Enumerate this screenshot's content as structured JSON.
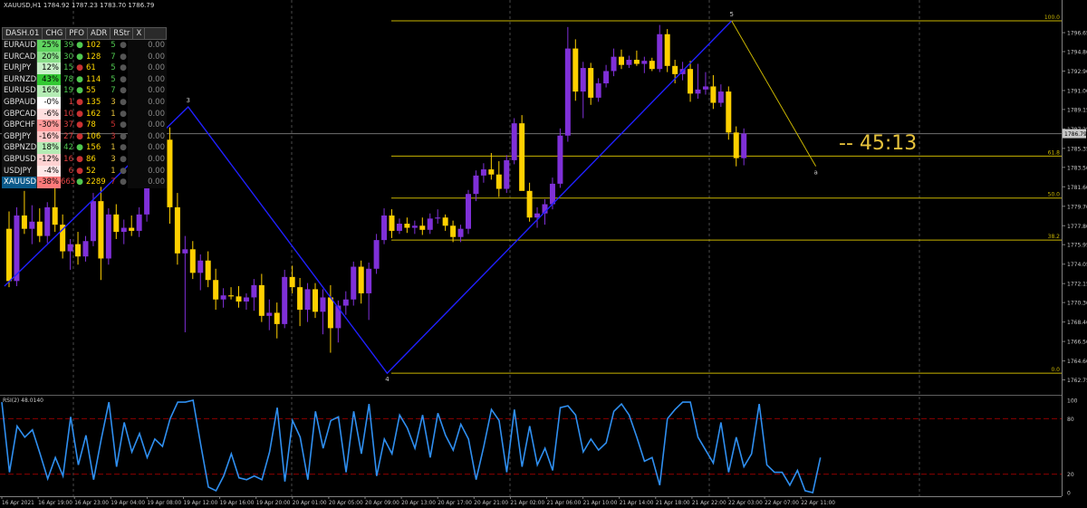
{
  "window": {
    "title": "XAUUSD,H1  1784.92 1787.23 1783.70 1786.79"
  },
  "colors": {
    "bull": "#7f30d8",
    "bear": "#ffd000",
    "zigzag": "#2020ff",
    "fib": "#c8b400",
    "rsi": "#2f8ff0",
    "rsi_level": "#8b0000",
    "grid": "#4a4a4a"
  },
  "dashboard": {
    "headers": [
      "DASH.01",
      "CHG",
      "PFO",
      "ADR",
      "RStr",
      "X"
    ],
    "rows": [
      {
        "sym": "EURAUD",
        "chg": "25%",
        "chg_color": "#5fd35f",
        "pfo": "39",
        "dot": "#50c850",
        "adr": "102",
        "rstr": "5",
        "rstr_color": "#50c850",
        "val": "0.00"
      },
      {
        "sym": "EURCAD",
        "chg": "20%",
        "chg_color": "#8be08b",
        "pfo": "30",
        "dot": "#50c850",
        "adr": "128",
        "rstr": "7",
        "rstr_color": "#50c850",
        "val": "0.00"
      },
      {
        "sym": "EURJPY",
        "chg": "12%",
        "chg_color": "#c8f0c8",
        "pfo": "15",
        "dot": "#c83232",
        "adr": "61",
        "rstr": "5",
        "rstr_color": "#50c850",
        "val": "0.00"
      },
      {
        "sym": "EURNZD",
        "chg": "43%",
        "chg_color": "#32c832",
        "pfo": "78",
        "dot": "#50c850",
        "adr": "114",
        "rstr": "5",
        "rstr_color": "#50c850",
        "val": "0.00"
      },
      {
        "sym": "EURUSD",
        "chg": "16%",
        "chg_color": "#b4ebb4",
        "pfo": "19",
        "dot": "#50c850",
        "adr": "55",
        "rstr": "7",
        "rstr_color": "#50c850",
        "val": "0.00"
      },
      {
        "sym": "GBPAUD",
        "chg": "-0%",
        "chg_color": "#ffffff",
        "pfo": "1",
        "dot": "#c83232",
        "adr": "135",
        "rstr": "3",
        "rstr_color": "#e6c23c",
        "val": "0.00"
      },
      {
        "sym": "GBPCAD",
        "chg": "-6%",
        "chg_color": "#ffe0e0",
        "pfo": "10",
        "dot": "#c83232",
        "adr": "162",
        "rstr": "1",
        "rstr_color": "#e6c23c",
        "val": "0.00"
      },
      {
        "sym": "GBPCHF",
        "chg": "-30%",
        "chg_color": "#ff9a9a",
        "pfo": "37",
        "dot": "#c83232",
        "adr": "78",
        "rstr": "5",
        "rstr_color": "#c83232",
        "val": "0.00"
      },
      {
        "sym": "GBPJPY",
        "chg": "-16%",
        "chg_color": "#ffc8c8",
        "pfo": "27",
        "dot": "#c83232",
        "adr": "106",
        "rstr": "3",
        "rstr_color": "#c83232",
        "val": "0.00"
      },
      {
        "sym": "GBPNZD",
        "chg": "18%",
        "chg_color": "#b4ebb4",
        "pfo": "42",
        "dot": "#50c850",
        "adr": "156",
        "rstr": "1",
        "rstr_color": "#e6c23c",
        "val": "0.00"
      },
      {
        "sym": "GBPUSD",
        "chg": "-12%",
        "chg_color": "#ffd2d2",
        "pfo": "16",
        "dot": "#c83232",
        "adr": "86",
        "rstr": "3",
        "rstr_color": "#e6c23c",
        "val": "0.00"
      },
      {
        "sym": "USDJPY",
        "chg": "-4%",
        "chg_color": "#ffe8e8",
        "pfo": "6",
        "dot": "#c83232",
        "adr": "52",
        "rstr": "1",
        "rstr_color": "#e6c23c",
        "val": "0.00"
      },
      {
        "sym": "XAUUSD",
        "chg": "-38%",
        "chg_color": "#ff7a7a",
        "pfo": "665",
        "dot": "#50c850",
        "adr": "2289",
        "rstr": "7",
        "rstr_color": "#c83232",
        "val": "0.00"
      }
    ]
  },
  "timer": {
    "text": "-- 45:13"
  },
  "price_axis": {
    "labels": [
      "1796.65",
      "1794.80",
      "1792.90",
      "1791.00",
      "1789.15",
      "1787.25",
      "1785.35",
      "1783.50",
      "1781.60",
      "1779.70",
      "1777.80",
      "1775.95",
      "1774.05",
      "1772.15",
      "1770.30",
      "1768.40",
      "1766.50",
      "1764.60",
      "1762.75"
    ],
    "current": "1786.79"
  },
  "fib_levels": [
    {
      "label": "100.0",
      "price": 1797.8
    },
    {
      "label": "61.8",
      "price": 1784.6
    },
    {
      "label": "50.0",
      "price": 1780.5
    },
    {
      "label": "38.2",
      "price": 1776.4
    },
    {
      "label": "0.0",
      "price": 1763.4
    }
  ],
  "zigzag_labels": [
    "3",
    "4",
    "5",
    "a"
  ],
  "time_axis": [
    "16 Apr 2021",
    "16 Apr 19:00",
    "16 Apr 23:00",
    "19 Apr 04:00",
    "19 Apr 08:00",
    "19 Apr 12:00",
    "19 Apr 16:00",
    "19 Apr 20:00",
    "20 Apr 01:00",
    "20 Apr 05:00",
    "20 Apr 09:00",
    "20 Apr 13:00",
    "20 Apr 17:00",
    "20 Apr 21:00",
    "21 Apr 02:00",
    "21 Apr 06:00",
    "21 Apr 10:00",
    "21 Apr 14:00",
    "21 Apr 18:00",
    "21 Apr 22:00",
    "22 Apr 03:00",
    "22 Apr 07:00",
    "22 Apr 11:00"
  ],
  "rsi": {
    "label": "RSI(2) 48.0140",
    "levels": [
      "100",
      "80",
      "20",
      "0"
    ],
    "values": [
      98,
      22,
      72,
      60,
      68,
      42,
      15,
      38,
      18,
      82,
      30,
      62,
      14,
      58,
      98,
      28,
      76,
      44,
      64,
      38,
      58,
      50,
      80,
      98,
      98,
      100,
      52,
      6,
      2,
      18,
      42,
      16,
      14,
      18,
      14,
      44,
      92,
      12,
      78,
      60,
      14,
      88,
      48,
      78,
      82,
      22,
      88,
      42,
      96,
      18,
      58,
      42,
      84,
      70,
      48,
      84,
      38,
      86,
      62,
      46,
      74,
      58,
      14,
      50,
      90,
      78,
      22,
      90,
      28,
      72,
      30,
      48,
      24,
      92,
      94,
      84,
      44,
      58,
      46,
      54,
      88,
      96,
      84,
      60,
      34,
      38,
      8,
      80,
      90,
      98,
      98,
      60,
      46,
      32,
      76,
      22,
      60,
      28,
      42,
      96,
      30,
      22,
      22,
      8,
      24,
      2,
      0,
      38
    ]
  },
  "chart_data": {
    "type": "candlestick",
    "symbol": "XAUUSD",
    "timeframe": "H1",
    "ylim": [
      1762.0,
      1798.6
    ],
    "candles": [
      [
        1777.5,
        1779.2,
        1771.8,
        1772.4
      ],
      [
        1772.4,
        1779.6,
        1771.9,
        1778.8
      ],
      [
        1778.8,
        1781.2,
        1777.0,
        1777.5
      ],
      [
        1777.5,
        1779.8,
        1776.0,
        1778.2
      ],
      [
        1778.2,
        1779.5,
        1776.2,
        1776.8
      ],
      [
        1776.8,
        1780.1,
        1776.1,
        1779.6
      ],
      [
        1779.6,
        1781.5,
        1777.2,
        1777.9
      ],
      [
        1777.9,
        1778.9,
        1774.6,
        1775.3
      ],
      [
        1775.3,
        1776.5,
        1773.5,
        1776.0
      ],
      [
        1776.0,
        1777.2,
        1774.0,
        1774.8
      ],
      [
        1774.8,
        1776.8,
        1774.3,
        1776.3
      ],
      [
        1776.3,
        1781.0,
        1775.8,
        1780.2
      ],
      [
        1780.2,
        1781.6,
        1772.5,
        1774.6
      ],
      [
        1774.6,
        1779.5,
        1774.0,
        1778.9
      ],
      [
        1778.9,
        1779.9,
        1776.5,
        1777.2
      ],
      [
        1777.2,
        1778.4,
        1776.0,
        1777.6
      ],
      [
        1777.6,
        1778.8,
        1776.8,
        1777.3
      ],
      [
        1777.3,
        1779.6,
        1776.7,
        1778.9
      ],
      [
        1778.9,
        1787.5,
        1778.2,
        1787.0
      ],
      [
        1787.0,
        1788.8,
        1785.8,
        1788.3
      ],
      [
        1788.3,
        1789.4,
        1785.6,
        1786.2
      ],
      [
        1786.2,
        1787.4,
        1778.0,
        1779.6
      ],
      [
        1779.6,
        1781.0,
        1774.0,
        1775.1
      ],
      [
        1775.1,
        1776.8,
        1767.4,
        1775.5
      ],
      [
        1775.5,
        1776.3,
        1772.6,
        1773.2
      ],
      [
        1773.2,
        1775.0,
        1771.5,
        1774.4
      ],
      [
        1774.4,
        1775.3,
        1771.8,
        1772.5
      ],
      [
        1772.5,
        1773.6,
        1769.6,
        1770.6
      ],
      [
        1770.6,
        1771.7,
        1769.8,
        1771.0
      ],
      [
        1771.0,
        1771.8,
        1770.6,
        1770.9
      ],
      [
        1770.9,
        1771.9,
        1769.8,
        1770.4
      ],
      [
        1770.4,
        1771.2,
        1769.6,
        1770.8
      ],
      [
        1770.8,
        1772.6,
        1769.5,
        1772.0
      ],
      [
        1772.0,
        1773.1,
        1768.4,
        1769.0
      ],
      [
        1769.0,
        1770.6,
        1767.6,
        1769.3
      ],
      [
        1769.3,
        1770.3,
        1766.8,
        1768.2
      ],
      [
        1768.2,
        1773.5,
        1767.8,
        1772.8
      ],
      [
        1772.8,
        1773.9,
        1771.2,
        1771.8
      ],
      [
        1771.8,
        1772.7,
        1768.0,
        1769.6
      ],
      [
        1769.6,
        1772.2,
        1768.4,
        1771.6
      ],
      [
        1771.6,
        1772.2,
        1768.8,
        1769.4
      ],
      [
        1769.4,
        1771.6,
        1767.2,
        1770.8
      ],
      [
        1770.8,
        1772.0,
        1765.4,
        1767.8
      ],
      [
        1767.8,
        1770.5,
        1766.4,
        1770.0
      ],
      [
        1770.0,
        1771.4,
        1769.1,
        1770.6
      ],
      [
        1770.6,
        1774.3,
        1770.0,
        1773.8
      ],
      [
        1773.8,
        1774.4,
        1770.2,
        1771.2
      ],
      [
        1771.2,
        1774.2,
        1768.6,
        1773.6
      ],
      [
        1773.6,
        1777.0,
        1773.1,
        1776.4
      ],
      [
        1776.4,
        1779.5,
        1776.0,
        1778.8
      ],
      [
        1778.8,
        1779.4,
        1776.6,
        1777.3
      ],
      [
        1777.3,
        1778.5,
        1777.0,
        1778.0
      ],
      [
        1778.0,
        1778.6,
        1777.1,
        1777.6
      ],
      [
        1777.6,
        1778.3,
        1777.0,
        1777.8
      ],
      [
        1777.8,
        1778.6,
        1776.9,
        1777.4
      ],
      [
        1777.4,
        1779.0,
        1777.0,
        1778.5
      ],
      [
        1778.5,
        1779.4,
        1778.0,
        1778.6
      ],
      [
        1778.6,
        1778.9,
        1777.3,
        1777.8
      ],
      [
        1777.8,
        1778.3,
        1776.2,
        1776.7
      ],
      [
        1776.7,
        1777.9,
        1776.2,
        1777.5
      ],
      [
        1777.5,
        1781.3,
        1777.0,
        1780.9
      ],
      [
        1780.9,
        1783.2,
        1780.2,
        1782.7
      ],
      [
        1782.7,
        1783.9,
        1782.0,
        1783.3
      ],
      [
        1783.3,
        1784.9,
        1782.3,
        1782.8
      ],
      [
        1782.8,
        1784.1,
        1780.6,
        1781.4
      ],
      [
        1781.4,
        1784.7,
        1781.0,
        1784.2
      ],
      [
        1784.2,
        1788.3,
        1783.8,
        1787.8
      ],
      [
        1787.8,
        1788.6,
        1784.3,
        1781.2
      ],
      [
        1781.2,
        1782.0,
        1778.2,
        1778.6
      ],
      [
        1778.6,
        1779.6,
        1777.6,
        1779.0
      ],
      [
        1779.0,
        1780.4,
        1777.9,
        1779.9
      ],
      [
        1779.9,
        1782.5,
        1779.4,
        1781.9
      ],
      [
        1781.9,
        1787.3,
        1781.5,
        1786.6
      ],
      [
        1786.6,
        1797.2,
        1786.0,
        1795.1
      ],
      [
        1795.1,
        1796.0,
        1790.0,
        1790.9
      ],
      [
        1790.9,
        1793.8,
        1788.3,
        1793.2
      ],
      [
        1793.2,
        1793.7,
        1789.6,
        1790.3
      ],
      [
        1790.3,
        1792.2,
        1789.9,
        1791.7
      ],
      [
        1791.7,
        1793.5,
        1791.3,
        1792.9
      ],
      [
        1792.9,
        1795.1,
        1792.4,
        1794.3
      ],
      [
        1794.3,
        1795.0,
        1793.1,
        1793.5
      ],
      [
        1793.5,
        1794.4,
        1793.2,
        1794.0
      ],
      [
        1794.0,
        1794.9,
        1793.4,
        1793.6
      ],
      [
        1793.6,
        1794.3,
        1792.7,
        1793.9
      ],
      [
        1793.9,
        1794.2,
        1792.9,
        1793.1
      ],
      [
        1793.1,
        1797.4,
        1792.8,
        1796.5
      ],
      [
        1796.5,
        1797.0,
        1792.8,
        1793.4
      ],
      [
        1793.4,
        1794.0,
        1791.7,
        1792.6
      ],
      [
        1792.6,
        1793.8,
        1792.0,
        1793.1
      ],
      [
        1793.1,
        1793.9,
        1789.9,
        1790.7
      ],
      [
        1790.7,
        1793.6,
        1790.2,
        1791.1
      ],
      [
        1791.1,
        1792.8,
        1790.6,
        1791.4
      ],
      [
        1791.4,
        1792.5,
        1789.2,
        1789.8
      ],
      [
        1789.8,
        1791.6,
        1789.4,
        1790.9
      ],
      [
        1790.9,
        1791.4,
        1786.2,
        1786.9
      ],
      [
        1786.9,
        1787.5,
        1783.6,
        1784.4
      ],
      [
        1784.4,
        1787.3,
        1783.7,
        1786.8
      ]
    ]
  }
}
